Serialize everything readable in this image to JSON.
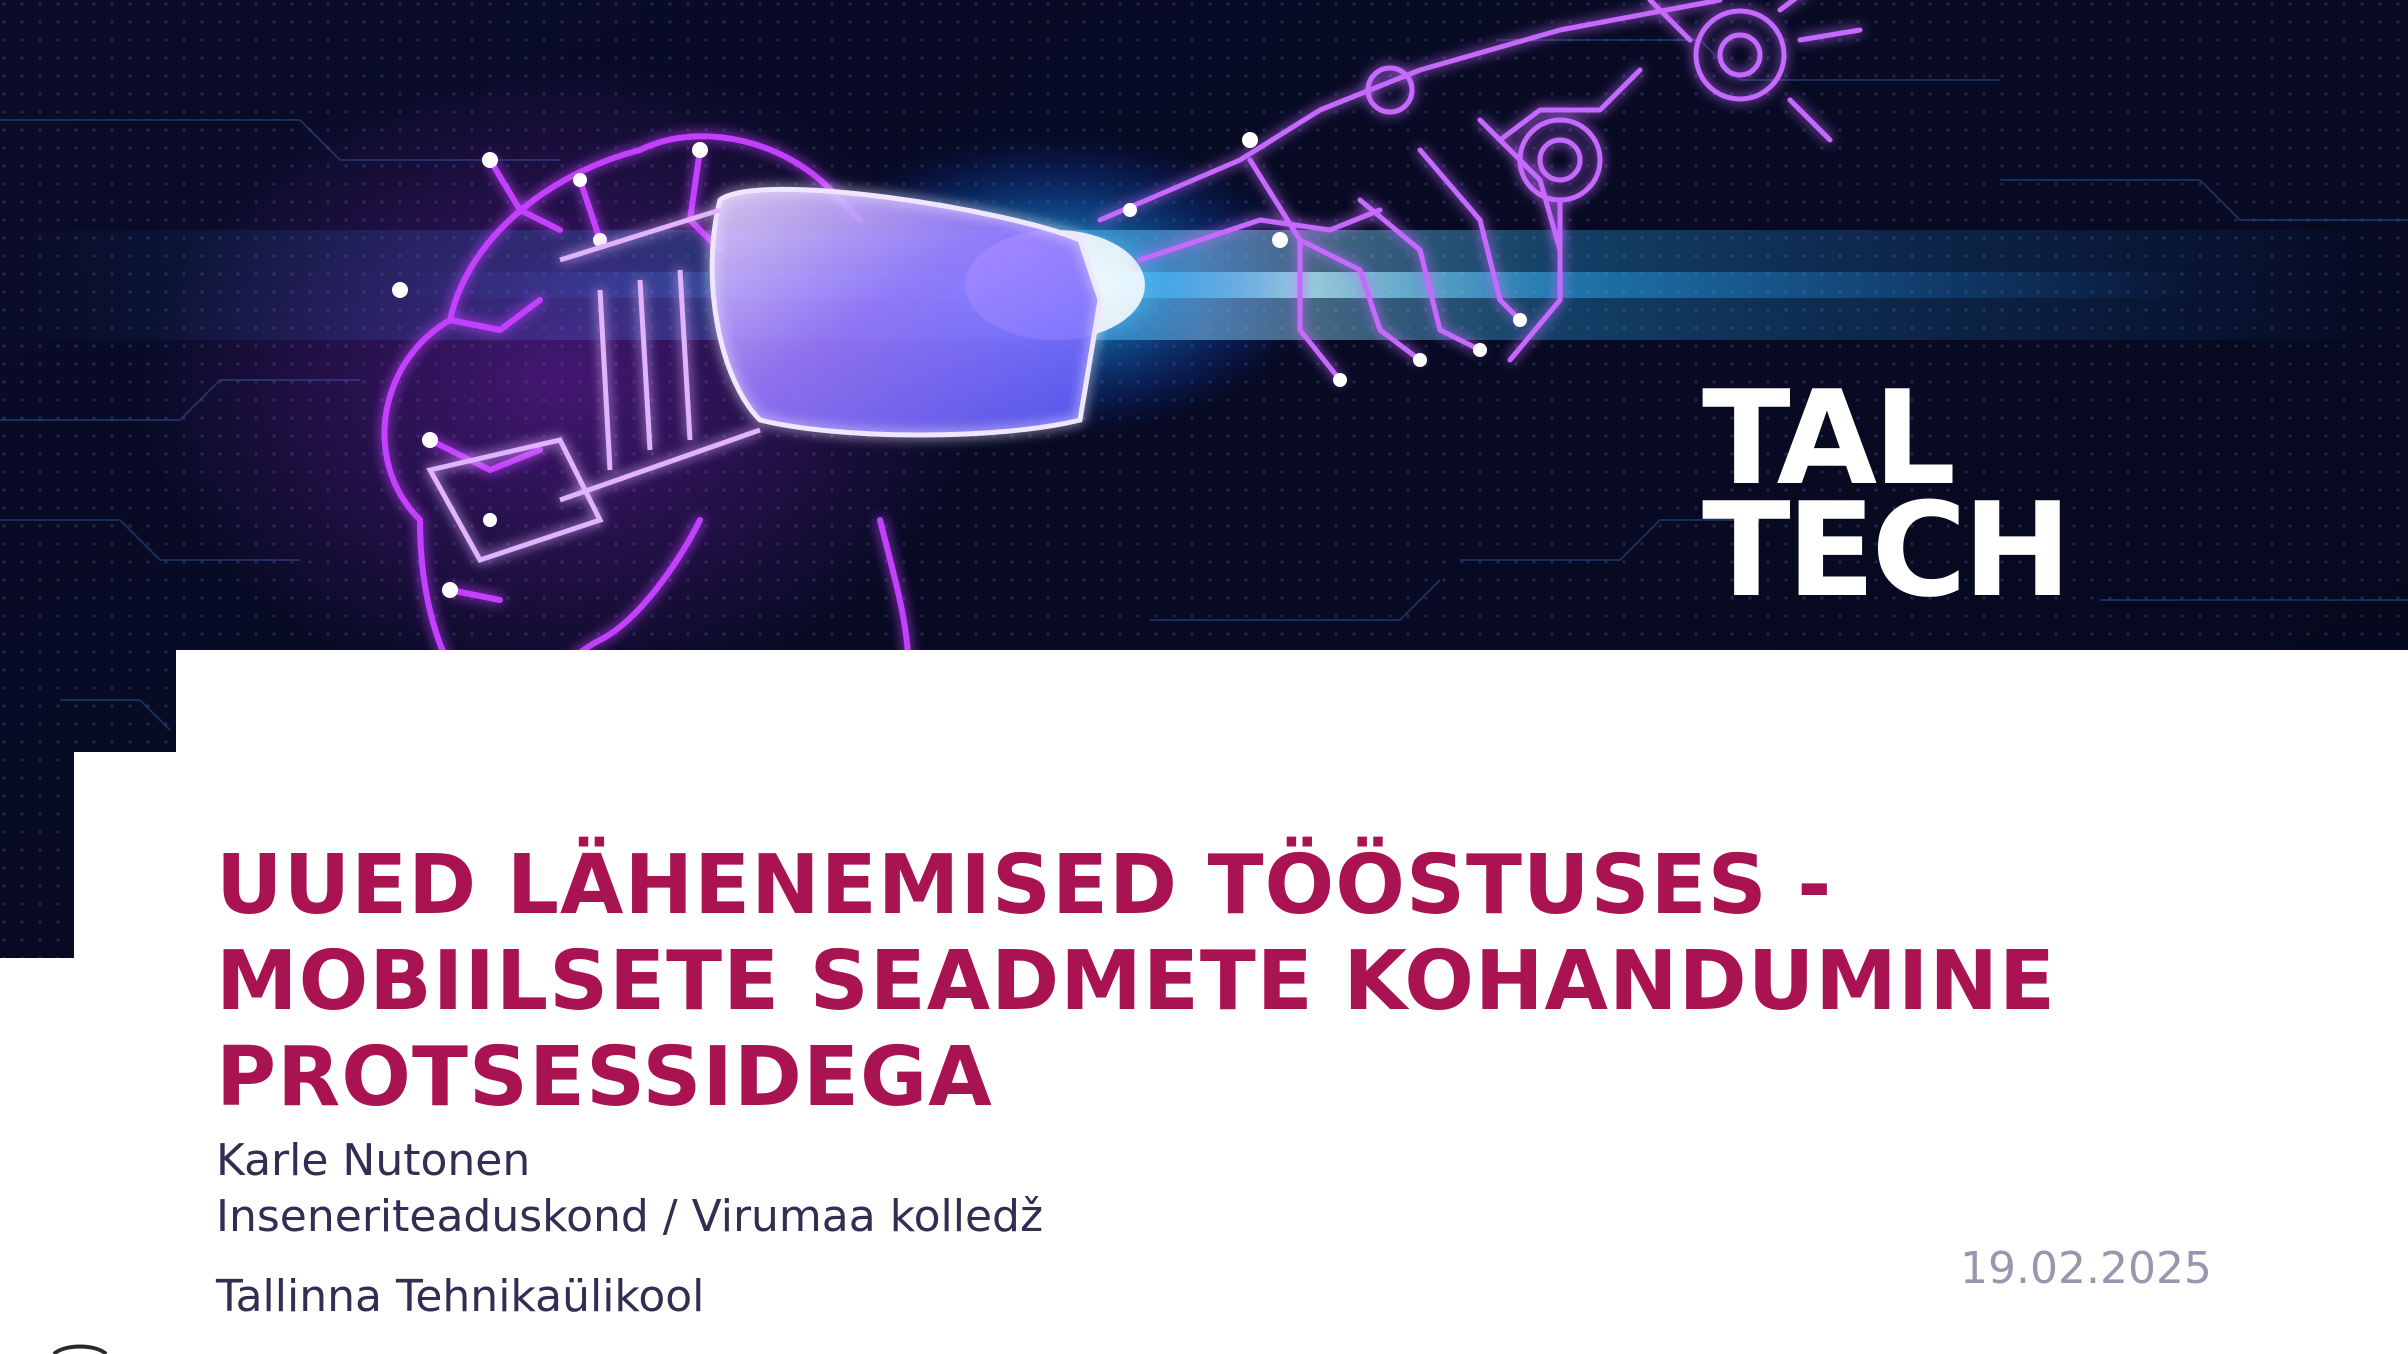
{
  "logo": {
    "line1": "TAL",
    "line2": "TECH"
  },
  "title": {
    "line1": "UUED LÄHENEMISED TÖÖSTUSES -",
    "line2": "MOBIILSETE SEADMETE KOHANDUMINE",
    "line3": "PROTSESSIDEGA"
  },
  "author": "Karle Nutonen",
  "faculty": "Inseneriteaduskond / Virumaa kolledž",
  "university": "Tallinna Tehnikaülikool",
  "date": "19.02.2025",
  "colors": {
    "title": "#aa1352",
    "text": "#302f52",
    "date": "#9797b0",
    "hero_bg": "#070a22",
    "neon_purple": "#c340ff",
    "neon_blue": "#29c8ff"
  },
  "icons": {
    "hero": "vr-headset-robot-hand-illustration"
  }
}
